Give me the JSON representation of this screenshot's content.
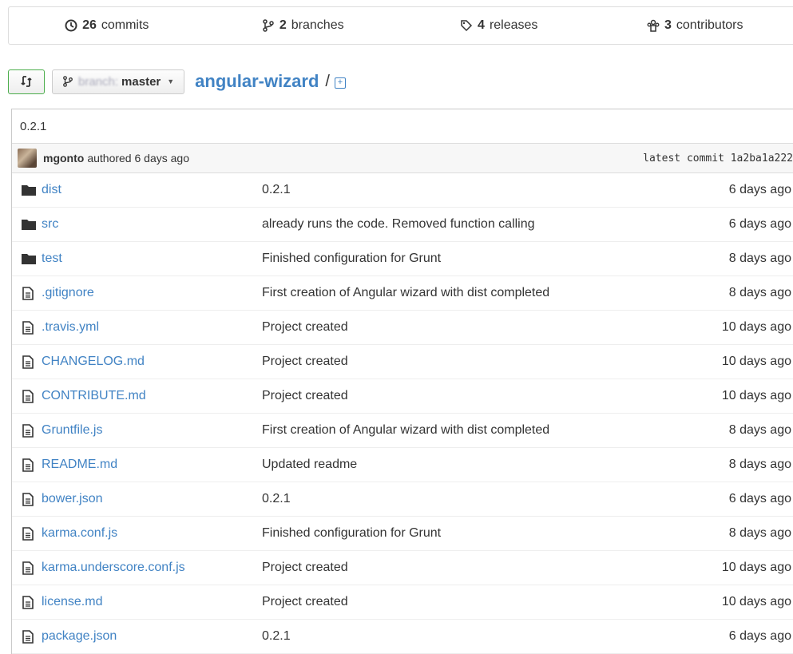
{
  "summary": {
    "commits": {
      "count": "26",
      "label": "commits"
    },
    "branches": {
      "count": "2",
      "label": "branches"
    },
    "releases": {
      "count": "4",
      "label": "releases"
    },
    "contributors": {
      "count": "3",
      "label": "contributors"
    }
  },
  "toolbar": {
    "branch_prefix": "branch:",
    "branch_name": "master",
    "repo_name": "angular-wizard",
    "separator": "/"
  },
  "commit": {
    "message": "0.2.1",
    "author": "mgonto",
    "authored_text": "authored 6 days ago",
    "latest_label": "latest commit 1a2ba1a222"
  },
  "files": [
    {
      "type": "dir",
      "name": "dist",
      "message": "0.2.1",
      "age": "6 days ago"
    },
    {
      "type": "dir",
      "name": "src",
      "message": "already runs the code. Removed function calling",
      "age": "6 days ago"
    },
    {
      "type": "dir",
      "name": "test",
      "message": "Finished configuration for Grunt",
      "age": "8 days ago"
    },
    {
      "type": "file",
      "name": ".gitignore",
      "message": "First creation of Angular wizard with dist completed",
      "age": "8 days ago"
    },
    {
      "type": "file",
      "name": ".travis.yml",
      "message": "Project created",
      "age": "10 days ago"
    },
    {
      "type": "file",
      "name": "CHANGELOG.md",
      "message": "Project created",
      "age": "10 days ago"
    },
    {
      "type": "file",
      "name": "CONTRIBUTE.md",
      "message": "Project created",
      "age": "10 days ago"
    },
    {
      "type": "file",
      "name": "Gruntfile.js",
      "message": "First creation of Angular wizard with dist completed",
      "age": "8 days ago"
    },
    {
      "type": "file",
      "name": "README.md",
      "message": "Updated readme",
      "age": "8 days ago"
    },
    {
      "type": "file",
      "name": "bower.json",
      "message": "0.2.1",
      "age": "6 days ago"
    },
    {
      "type": "file",
      "name": "karma.conf.js",
      "message": "Finished configuration for Grunt",
      "age": "8 days ago"
    },
    {
      "type": "file",
      "name": "karma.underscore.conf.js",
      "message": "Project created",
      "age": "10 days ago"
    },
    {
      "type": "file",
      "name": "license.md",
      "message": "Project created",
      "age": "10 days ago"
    },
    {
      "type": "file",
      "name": "package.json",
      "message": "0.2.1",
      "age": "6 days ago"
    }
  ],
  "colors": {
    "link": "#4183c4",
    "folder": "#333333",
    "compare_border": "#4cae4c"
  }
}
